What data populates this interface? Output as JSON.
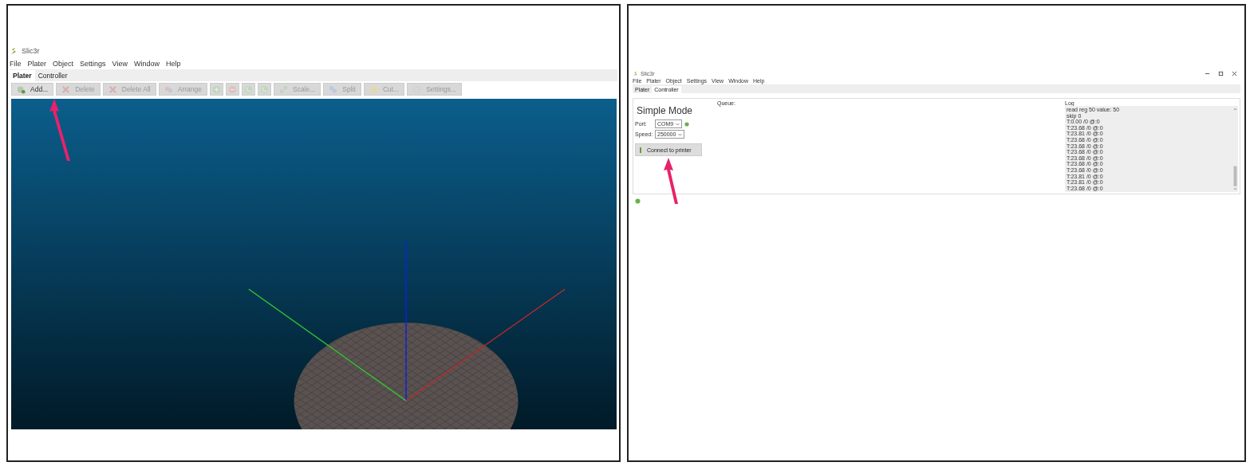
{
  "panels": [
    {
      "kind": "plater",
      "app_title": "Slic3r",
      "menu": [
        "File",
        "Plater",
        "Object",
        "Settings",
        "View",
        "Window",
        "Help"
      ],
      "tabs": [
        {
          "label": "Plater",
          "selected": true
        },
        {
          "label": "Controller",
          "selected": false
        }
      ],
      "toolbar": [
        {
          "kind": "add",
          "label": "Add...",
          "disabled": false
        },
        {
          "kind": "delete",
          "label": "Delete",
          "disabled": true
        },
        {
          "kind": "delete",
          "label": "Delete All",
          "disabled": true
        },
        {
          "kind": "arrange",
          "label": "Arrange",
          "disabled": true
        },
        {
          "kind": "plus",
          "disabled": true
        },
        {
          "kind": "minus",
          "disabled": true
        },
        {
          "kind": "rotate",
          "disabled": true
        },
        {
          "kind": "rotate",
          "disabled": true
        },
        {
          "kind": "scale",
          "label": "Scale...",
          "disabled": true
        },
        {
          "kind": "split",
          "label": "Split",
          "disabled": true
        },
        {
          "kind": "cut",
          "label": "Cut...",
          "disabled": true
        },
        {
          "kind": "settings",
          "label": "Settings...",
          "disabled": true
        }
      ]
    },
    {
      "kind": "controller",
      "app_title": "Slic3r",
      "menu": [
        "File",
        "Plater",
        "Object",
        "Settings",
        "View",
        "Window",
        "Help"
      ],
      "tabs": [
        {
          "label": "Plater",
          "selected": false
        },
        {
          "label": "Controller",
          "selected": true
        }
      ],
      "heading": "Simple Mode",
      "port_label": "Port:",
      "port": "COM9",
      "speed_label": "Speed:",
      "speed": "250000",
      "connect_button": "Connect to printer",
      "queue_label": "Queue:",
      "log_label": "Log",
      "log": [
        "read reg 50 value: 50",
        "skip 0",
        "T:0.00 /0 @:0",
        "T:23.68 /0 @:0",
        "T:23.81 /0 @:0",
        "T:23.68 /0 @:0",
        "T:23.68 /0 @:0",
        "T:23.68 /0 @:0",
        "T:23.68 /0 @:0",
        "T:23.68 /0 @:0",
        "T:23.68 /0 @:0",
        "T:23.81 /0 @:0",
        "T:23.81 /0 @:0",
        "T:23.68 /0 @:0"
      ]
    }
  ]
}
